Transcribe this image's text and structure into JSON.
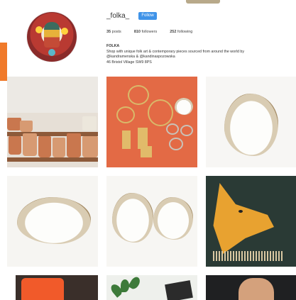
{
  "profile": {
    "username": "_folka_",
    "follow_label": "Follow",
    "stats": {
      "posts_value": "35",
      "posts_label": "posts",
      "followers_value": "810",
      "followers_label": "followers",
      "following_value": "252",
      "following_label": "following"
    },
    "bio": {
      "name": "FOLKA",
      "line1": "Shop with unique folk art & contemporary pieces sourced from around the world by",
      "line2": "@kandramenska & @kandinaspozowska",
      "line3": "46 Bristol Village SW9 8PS"
    },
    "avatar_icon": "avatar-image"
  },
  "colors": {
    "follow_button": "#3f93e8",
    "accent_orange": "#f07a2a"
  },
  "grid": {
    "posts": [
      {
        "name": "terracotta-pots-post"
      },
      {
        "name": "brass-jewelry-post"
      },
      {
        "name": "ceramic-shell-dish-post"
      },
      {
        "name": "oyster-shell-dish-post"
      },
      {
        "name": "two-shell-dishes-post"
      },
      {
        "name": "embroidered-fox-post"
      },
      {
        "name": "orange-mug-post"
      },
      {
        "name": "plant-post"
      },
      {
        "name": "hand-rings-post"
      }
    ]
  }
}
